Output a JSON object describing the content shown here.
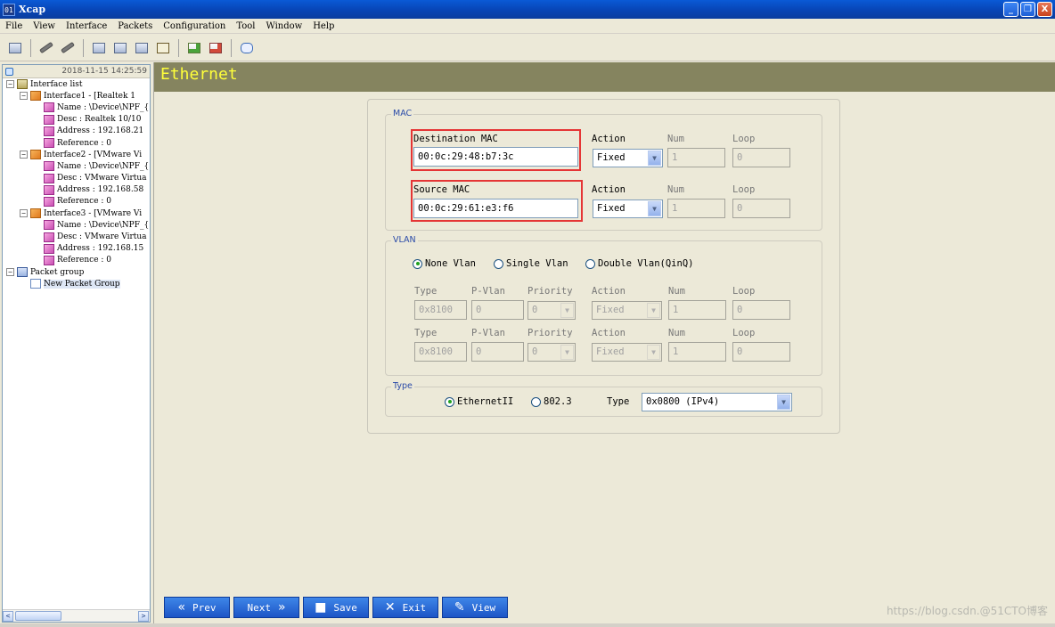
{
  "window": {
    "app_icon": "01",
    "title": "Xcap",
    "buttons": [
      "_",
      "❐",
      "X"
    ]
  },
  "menu": [
    "File",
    "View",
    "Interface",
    "Packets",
    "Configuration",
    "Tool",
    "Window",
    "Help"
  ],
  "toolbar": {
    "groups": [
      [
        "window-icon"
      ],
      [
        "plug-icon",
        "plug-dropdown-icon"
      ],
      [
        "percent-icon",
        "percent-alt-icon",
        "export-icon",
        "book-icon"
      ],
      [
        "doc-green-icon",
        "doc-red-icon"
      ],
      [
        "chat-icon"
      ]
    ]
  },
  "left_panel": {
    "timestamp": "2018-11-15 14:25:59",
    "tree": [
      {
        "level": 0,
        "expander": "−",
        "icon": "list",
        "text": "Interface list"
      },
      {
        "level": 1,
        "expander": "−",
        "icon": "iface",
        "text": "Interface1 - [Realtek 1"
      },
      {
        "level": 2,
        "icon": "prop",
        "text": "Name : \\Device\\NPF_{"
      },
      {
        "level": 2,
        "icon": "prop",
        "text": "Desc : Realtek 10/10"
      },
      {
        "level": 2,
        "icon": "prop",
        "text": "Address : 192.168.21"
      },
      {
        "level": 2,
        "icon": "prop",
        "text": "Reference : 0"
      },
      {
        "level": 1,
        "expander": "−",
        "icon": "iface",
        "text": "Interface2 - [VMware Vi"
      },
      {
        "level": 2,
        "icon": "prop",
        "text": "Name : \\Device\\NPF_{"
      },
      {
        "level": 2,
        "icon": "prop",
        "text": "Desc : VMware Virtua"
      },
      {
        "level": 2,
        "icon": "prop",
        "text": "Address : 192.168.58"
      },
      {
        "level": 2,
        "icon": "prop",
        "text": "Reference : 0"
      },
      {
        "level": 1,
        "expander": "−",
        "icon": "iface",
        "text": "Interface3 - [VMware Vi"
      },
      {
        "level": 2,
        "icon": "prop",
        "text": "Name : \\Device\\NPF_{"
      },
      {
        "level": 2,
        "icon": "prop",
        "text": "Desc : VMware Virtua"
      },
      {
        "level": 2,
        "icon": "prop",
        "text": "Address : 192.168.15"
      },
      {
        "level": 2,
        "icon": "prop",
        "text": "Reference : 0"
      },
      {
        "level": 0,
        "expander": "−",
        "icon": "group",
        "text": "Packet group"
      },
      {
        "level": 1,
        "icon": "blank",
        "text": "New Packet Group",
        "selected": true
      }
    ]
  },
  "page": {
    "title": "Ethernet"
  },
  "mac": {
    "legend": "MAC",
    "dest": {
      "label": "Destination MAC",
      "value": "00:0c:29:48:b7:3c",
      "action_label": "Action",
      "action": "Fixed",
      "num_label": "Num",
      "num": "1",
      "loop_label": "Loop",
      "loop": "0"
    },
    "src": {
      "label": "Source MAC",
      "value": "00:0c:29:61:e3:f6",
      "action_label": "Action",
      "action": "Fixed",
      "num_label": "Num",
      "num": "1",
      "loop_label": "Loop",
      "loop": "0"
    }
  },
  "vlan": {
    "legend": "VLAN",
    "options": [
      "None Vlan",
      "Single Vlan",
      "Double Vlan(QinQ)"
    ],
    "selected": 0,
    "headers": [
      "Type",
      "P-Vlan",
      "Priority",
      "Action",
      "Num",
      "Loop"
    ],
    "rows": [
      {
        "type": "0x8100",
        "pvlan": "0",
        "priority": "0",
        "action": "Fixed",
        "num": "1",
        "loop": "0"
      },
      {
        "type": "0x8100",
        "pvlan": "0",
        "priority": "0",
        "action": "Fixed",
        "num": "1",
        "loop": "0"
      }
    ]
  },
  "type_group": {
    "legend": "Type",
    "options": [
      "EthernetII",
      "802.3"
    ],
    "selected": 0,
    "type_label": "Type",
    "type_value": "0x0800 (IPv4)"
  },
  "buttons": {
    "prev": {
      "glyph": "«",
      "label": "Prev"
    },
    "next": {
      "glyph": "»",
      "label": "Next"
    },
    "save": {
      "glyph": "■",
      "label": "Save"
    },
    "exit": {
      "glyph": "✕",
      "label": "Exit"
    },
    "view": {
      "glyph": "✎",
      "label": "View"
    }
  },
  "watermark": "https://blog.csdn.@51CTO博客"
}
